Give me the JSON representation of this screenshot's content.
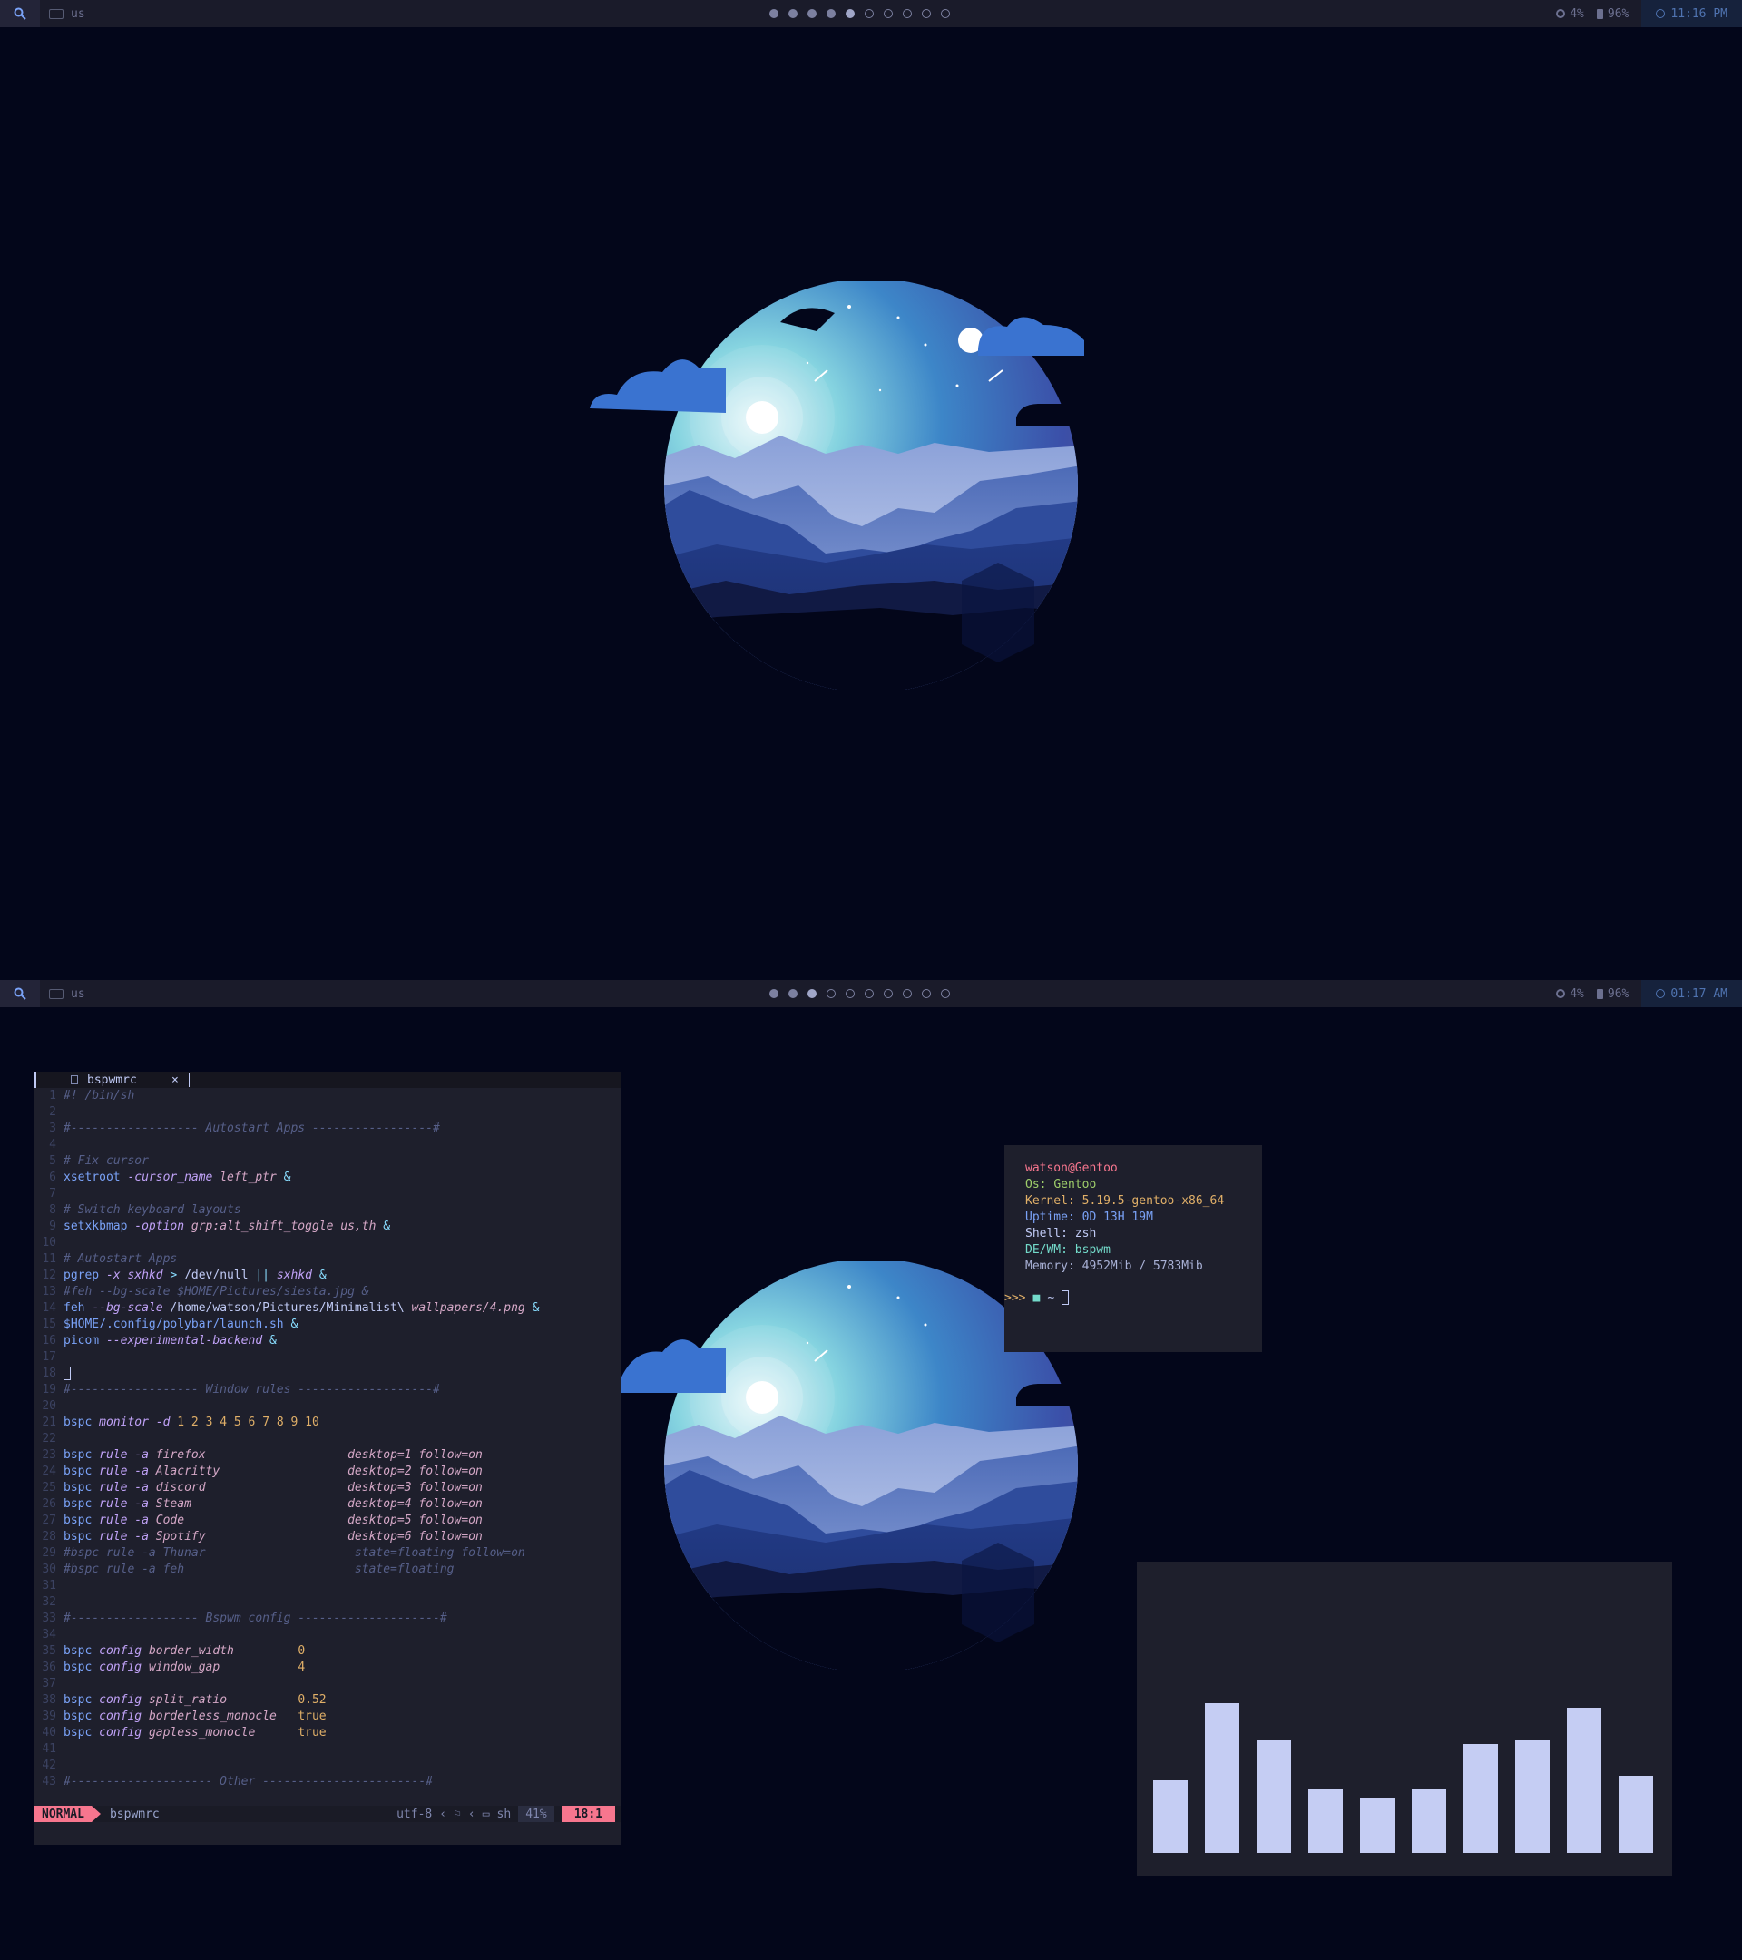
{
  "top_bar": {
    "keyboard_layout": "us",
    "cpu": "4%",
    "battery": "96%",
    "clock": "11:16 PM",
    "workspaces": [
      "occupied",
      "occupied",
      "occupied",
      "occupied",
      "active",
      "empty",
      "empty",
      "empty",
      "empty",
      "empty"
    ]
  },
  "bottom_bar": {
    "keyboard_layout": "us",
    "cpu": "4%",
    "battery": "96%",
    "clock": "01:17 AM",
    "workspaces": [
      "occupied",
      "occupied",
      "active",
      "empty",
      "empty",
      "empty",
      "empty",
      "empty",
      "empty",
      "empty"
    ]
  },
  "editor": {
    "tab_name": "bspwmrc",
    "tab_close": "×",
    "lines": [
      {
        "n": "1",
        "code": "#! /bin/sh"
      },
      {
        "n": "2",
        "code": ""
      },
      {
        "n": "3",
        "code": "#------------------ Autostart Apps -----------------#"
      },
      {
        "n": "4",
        "code": ""
      },
      {
        "n": "5",
        "code": "# Fix cursor"
      },
      {
        "n": "6",
        "code": "xsetroot -cursor_name left_ptr &"
      },
      {
        "n": "7",
        "code": ""
      },
      {
        "n": "8",
        "code": "# Switch keyboard layouts"
      },
      {
        "n": "9",
        "code": "setxkbmap -option grp:alt_shift_toggle us,th &"
      },
      {
        "n": "10",
        "code": ""
      },
      {
        "n": "11",
        "code": "# Autostart Apps"
      },
      {
        "n": "12",
        "code": "pgrep -x sxhkd > /dev/null || sxhkd &"
      },
      {
        "n": "13",
        "code": "#feh --bg-scale $HOME/Pictures/siesta.jpg &"
      },
      {
        "n": "14",
        "code": "feh --bg-scale /home/watson/Pictures/Minimalist\\ wallpapers/4.png &"
      },
      {
        "n": "15",
        "code": "$HOME/.config/polybar/launch.sh &"
      },
      {
        "n": "16",
        "code": "picom --experimental-backend &"
      },
      {
        "n": "17",
        "code": ""
      },
      {
        "n": "18",
        "code": ""
      },
      {
        "n": "19",
        "code": "#------------------ Window rules -------------------#"
      },
      {
        "n": "20",
        "code": ""
      },
      {
        "n": "21",
        "code": "bspc monitor -d 1 2 3 4 5 6 7 8 9 10"
      },
      {
        "n": "22",
        "code": ""
      },
      {
        "n": "23",
        "code": "bspc rule -a firefox                    desktop=1 follow=on"
      },
      {
        "n": "24",
        "code": "bspc rule -a Alacritty                  desktop=2 follow=on"
      },
      {
        "n": "25",
        "code": "bspc rule -a discord                    desktop=3 follow=on"
      },
      {
        "n": "26",
        "code": "bspc rule -a Steam                      desktop=4 follow=on"
      },
      {
        "n": "27",
        "code": "bspc rule -a Code                       desktop=5 follow=on"
      },
      {
        "n": "28",
        "code": "bspc rule -a Spotify                    desktop=6 follow=on"
      },
      {
        "n": "29",
        "code": "#bspc rule -a Thunar                     state=floating follow=on"
      },
      {
        "n": "30",
        "code": "#bspc rule -a feh                        state=floating"
      },
      {
        "n": "31",
        "code": ""
      },
      {
        "n": "32",
        "code": ""
      },
      {
        "n": "33",
        "code": "#------------------ Bspwm config --------------------#"
      },
      {
        "n": "34",
        "code": ""
      },
      {
        "n": "35",
        "code": "bspc config border_width         0"
      },
      {
        "n": "36",
        "code": "bspc config window_gap           4"
      },
      {
        "n": "37",
        "code": ""
      },
      {
        "n": "38",
        "code": "bspc config split_ratio          0.52"
      },
      {
        "n": "39",
        "code": "bspc config borderless_monocle   true"
      },
      {
        "n": "40",
        "code": "bspc config gapless_monocle      true"
      },
      {
        "n": "41",
        "code": ""
      },
      {
        "n": "42",
        "code": ""
      },
      {
        "n": "43",
        "code": "#-------------------- Other -----------------------#"
      }
    ],
    "status": {
      "mode": "NORMAL",
      "file": "bspwmrc",
      "encoding": "utf-8",
      "filetype": "sh",
      "percent": "41%",
      "position": "18:1"
    }
  },
  "fetch": {
    "user_host": "watson@Gentoo",
    "rows": [
      {
        "key": "Os:",
        "value": "Gentoo"
      },
      {
        "key": "Kernel:",
        "value": "5.19.5-gentoo-x86_64"
      },
      {
        "key": "Uptime:",
        "value": "0D 13H 19M"
      },
      {
        "key": "Shell:",
        "value": "zsh"
      },
      {
        "key": "DE/WM:",
        "value": "bspwm"
      },
      {
        "key": "Memory:",
        "value": "4952Mib / 5783Mib"
      }
    ],
    "prompt": ">>>",
    "dir": "~"
  },
  "visualizer": {
    "levels": [
      0.32,
      0.66,
      0.5,
      0.28,
      0.24,
      0.28,
      0.48,
      0.5,
      0.64,
      0.34
    ]
  },
  "colors": {
    "background": "#03061a",
    "bar": "#1a1b2a",
    "accent_pink": "#f7768e",
    "accent_blue": "#7aa2f7",
    "visualizer_bar": "#c5cdf3"
  }
}
